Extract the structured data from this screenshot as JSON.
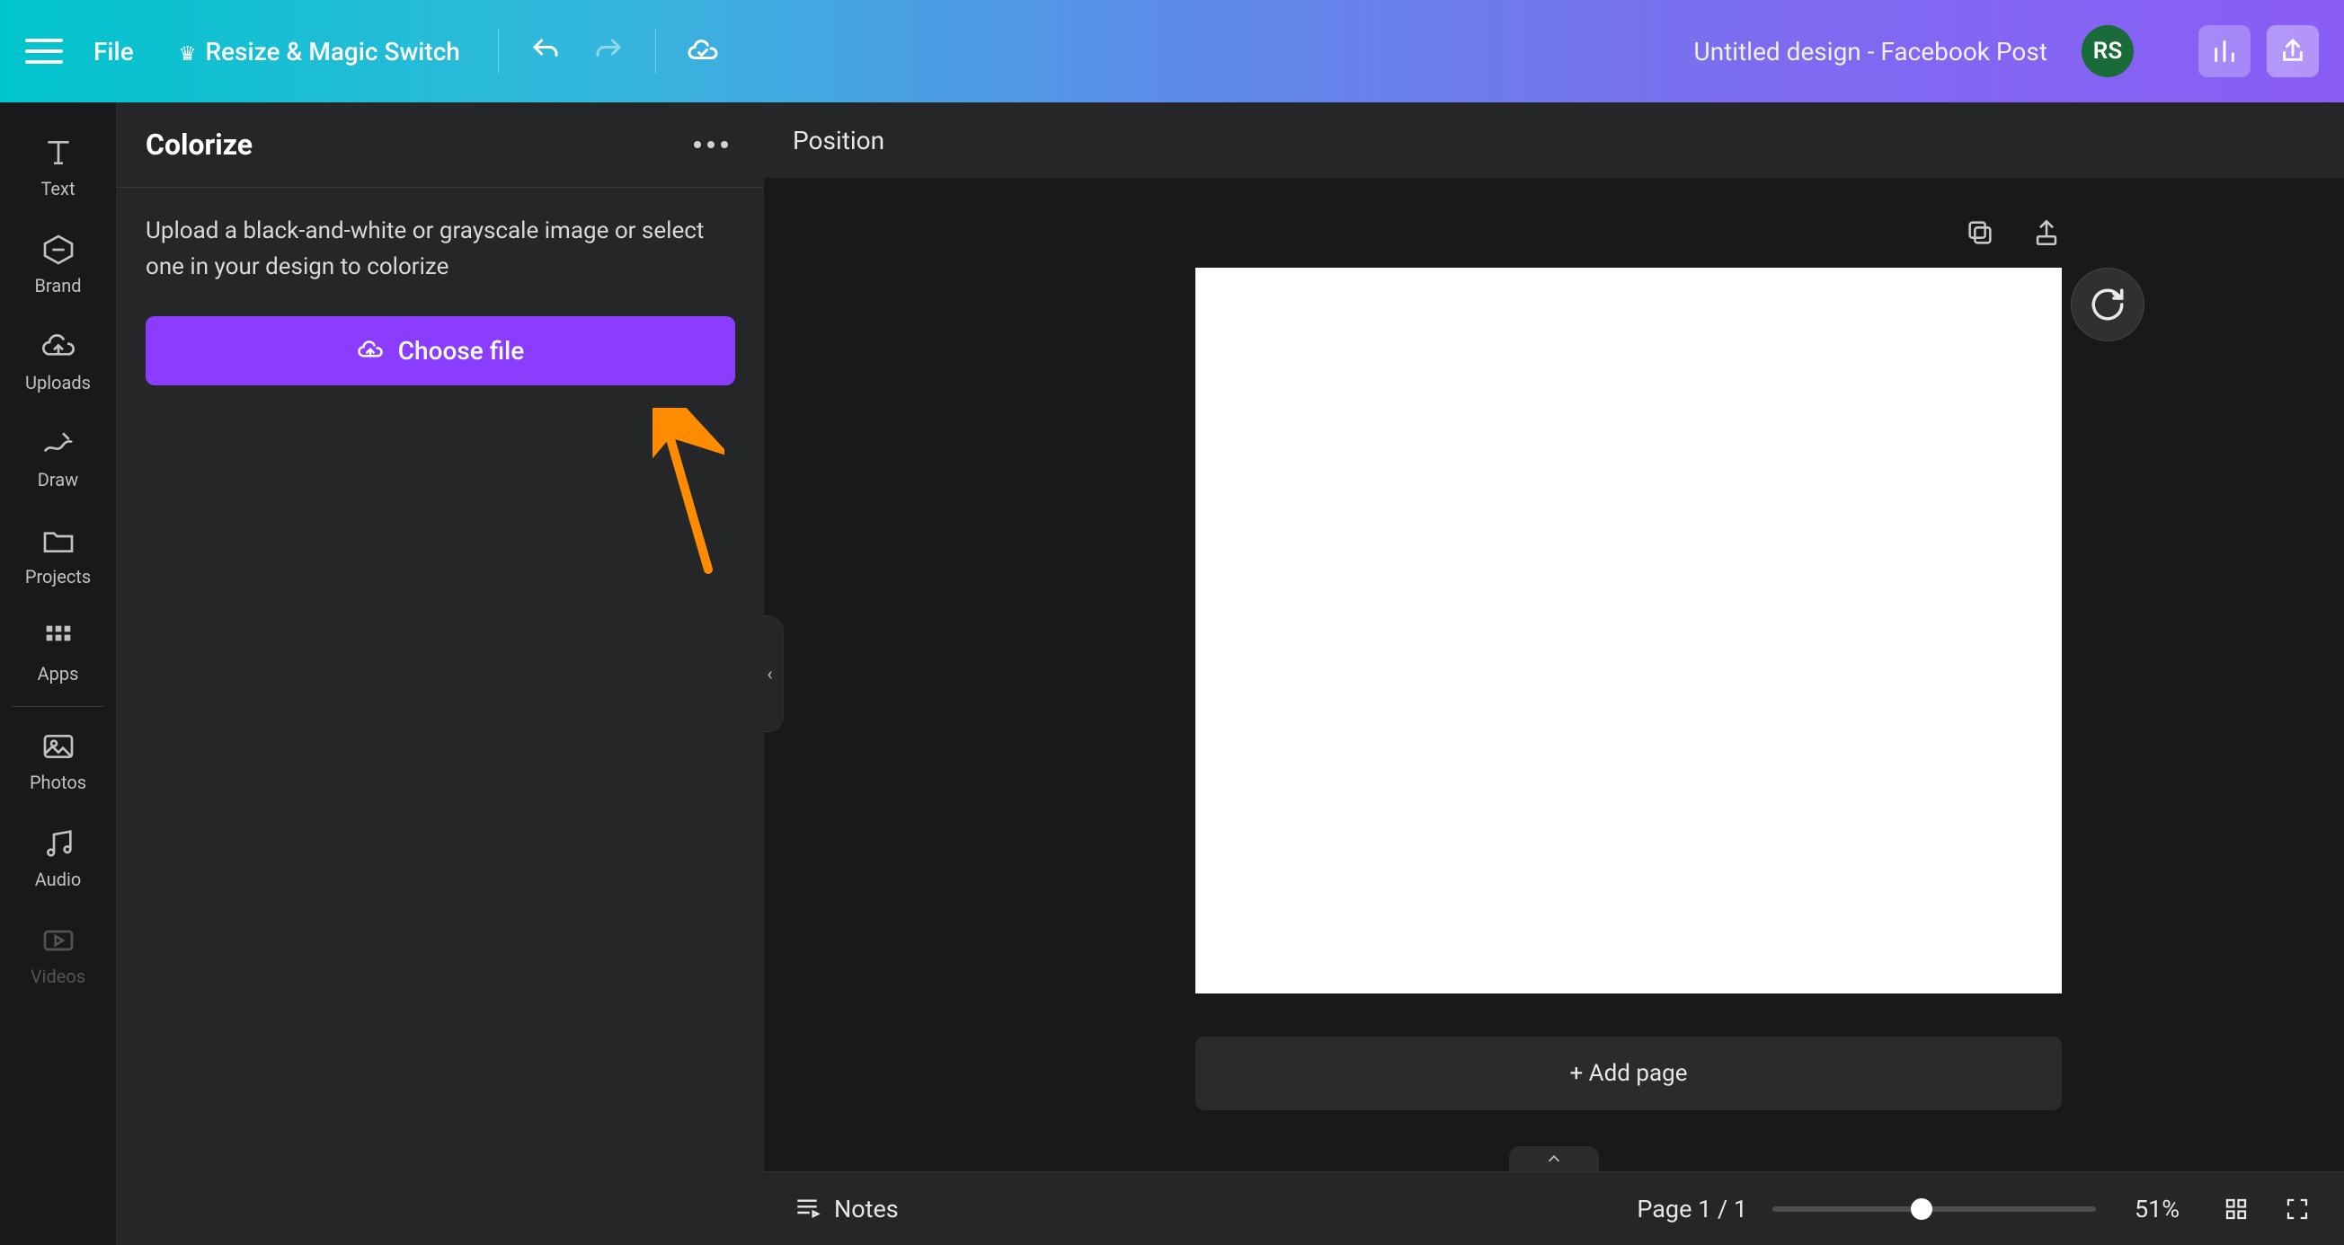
{
  "topbar": {
    "file_label": "File",
    "resize_label": "Resize & Magic Switch",
    "doc_title": "Untitled design - Facebook Post",
    "avatar_initials": "RS"
  },
  "rail": {
    "items": [
      {
        "id": "text",
        "label": "Text"
      },
      {
        "id": "brand",
        "label": "Brand"
      },
      {
        "id": "uploads",
        "label": "Uploads"
      },
      {
        "id": "draw",
        "label": "Draw"
      },
      {
        "id": "projects",
        "label": "Projects"
      },
      {
        "id": "apps",
        "label": "Apps"
      },
      {
        "id": "photos",
        "label": "Photos"
      },
      {
        "id": "audio",
        "label": "Audio"
      },
      {
        "id": "videos",
        "label": "Videos"
      }
    ]
  },
  "panel": {
    "title": "Colorize",
    "description": "Upload a black-and-white or grayscale image or select one in your design to colorize",
    "choose_file_label": "Choose file"
  },
  "canvas": {
    "position_label": "Position",
    "add_page_label": "+ Add page"
  },
  "bottombar": {
    "notes_label": "Notes",
    "page_indicator": "Page 1 / 1",
    "zoom_percent": "51%"
  }
}
